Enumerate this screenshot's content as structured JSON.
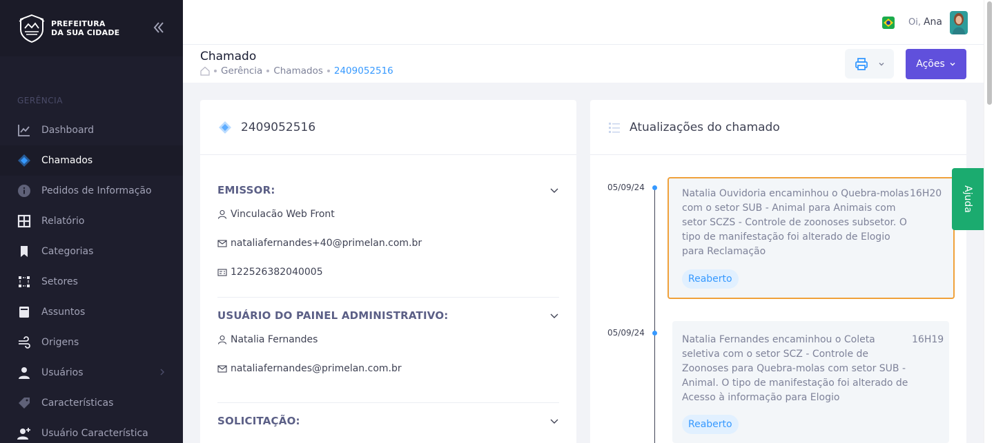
{
  "brand": {
    "line1": "PREFEITURA",
    "line2": "DA SUA CIDADE"
  },
  "sidebar": {
    "section": "GERÊNCIA",
    "items": [
      {
        "label": "Dashboard",
        "icon": "chart-line-icon"
      },
      {
        "label": "Chamados",
        "icon": "ticket-icon",
        "active": true
      },
      {
        "label": "Pedidos de Informação",
        "icon": "info-icon"
      },
      {
        "label": "Relatório",
        "icon": "grid-icon"
      },
      {
        "label": "Categorias",
        "icon": "bookmark-icon"
      },
      {
        "label": "Setores",
        "icon": "sectors-icon"
      },
      {
        "label": "Assuntos",
        "icon": "book-icon"
      },
      {
        "label": "Origens",
        "icon": "wind-icon"
      },
      {
        "label": "Usuários",
        "icon": "user-icon",
        "has_submenu": true
      },
      {
        "label": "Características",
        "icon": "tag-icon"
      },
      {
        "label": "Usuário Característica",
        "icon": "user-plus-icon"
      }
    ]
  },
  "header": {
    "greeting": "Oi,",
    "user_name": "Ana"
  },
  "subheader": {
    "title": "Chamado",
    "breadcrumb": [
      "Gerência",
      "Chamados",
      "2409052516"
    ],
    "actions_label": "Ações"
  },
  "ticket": {
    "number": "2409052516",
    "emissor": {
      "title": "EMISSOR:",
      "name": "Vinculacão Web Front",
      "email": "nataliafernandes+40@primelan.com.br",
      "doc": "122526382040005"
    },
    "admin_user": {
      "title": "USUÁRIO DO PAINEL ADMINISTRATIVO:",
      "name": "Natalia Fernandes",
      "email": "nataliafernandes@primelan.com.br"
    },
    "solicitacao": {
      "title": "SOLICITAÇÃO:"
    }
  },
  "updates": {
    "title": "Atualizações do chamado",
    "items": [
      {
        "date": "05/09/24",
        "time": "16H20",
        "text": "Natalia Ouvidoria encaminhou o Quebra-molas com o setor SUB - Animal para Animais com setor SCZS - Controle de zoonoses subsetor. O tipo de manifestação foi alterado de Elogio para Reclamação",
        "status": "Reaberto"
      },
      {
        "date": "05/09/24",
        "time": "16H19",
        "text": "Natalia Fernandes encaminhou o Coleta seletiva com o setor SCZ - Controle de Zoonoses para Quebra-molas com setor SUB - Animal. O tipo de manifestação foi alterado de Acesso à informação para Elogio",
        "status": "Reaberto"
      }
    ]
  },
  "help_label": "Ajuda",
  "colors": {
    "accent": "#6050dc",
    "primary": "#3699ff",
    "sidebar": "#1e1e2d",
    "help": "#1bab6f",
    "highlight": "#f0a13a"
  }
}
